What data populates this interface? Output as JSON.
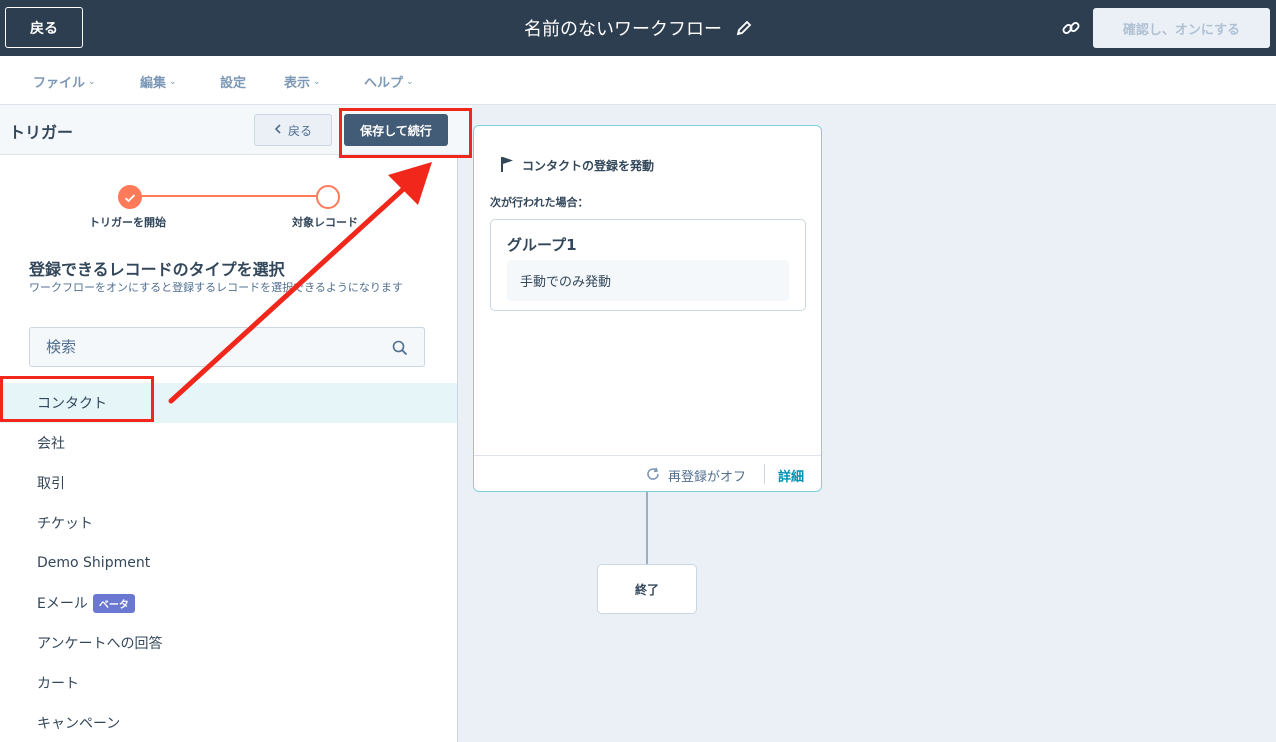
{
  "topbar": {
    "back_label": "戻る",
    "workflow_title": "名前のないワークフロー",
    "confirm_label": "確認し、オンにする"
  },
  "menu": {
    "items": [
      {
        "label": "ファイル",
        "has_dropdown": true
      },
      {
        "label": "編集",
        "has_dropdown": true
      },
      {
        "label": "設定",
        "has_dropdown": false
      },
      {
        "label": "表示",
        "has_dropdown": true
      },
      {
        "label": "ヘルプ",
        "has_dropdown": true
      }
    ]
  },
  "panel": {
    "title": "トリガー",
    "back_label": "戻る",
    "save_continue_label": "保存して続行",
    "steps": [
      {
        "label": "トリガーを開始",
        "done": true
      },
      {
        "label": "対象レコード",
        "done": false
      }
    ],
    "heading": "登録できるレコードのタイプを選択",
    "subheading": "ワークフローをオンにすると登録するレコードを選択できるようになります",
    "search_placeholder": "検索",
    "record_types": [
      {
        "label": "コンタクト",
        "selected": true
      },
      {
        "label": "会社"
      },
      {
        "label": "取引"
      },
      {
        "label": "チケット"
      },
      {
        "label": "Demo Shipment"
      },
      {
        "label": "Eメール",
        "badge": "ベータ"
      },
      {
        "label": "アンケートへの回答"
      },
      {
        "label": "カート"
      },
      {
        "label": "キャンペーン"
      }
    ]
  },
  "canvas": {
    "trigger_title": "コンタクトの登録を発動",
    "condition_label": "次が行われた場合：",
    "group_title": "グループ1",
    "group_condition": "手動でのみ発動",
    "reenroll_label": "再登録がオフ",
    "details_label": "詳細",
    "end_label": "終了"
  },
  "colors": {
    "topbar_bg": "#2d3e50",
    "accent_orange": "#ff7a59",
    "annotation_red": "#f0271a",
    "link_teal": "#0091ae",
    "beta_badge": "#6a78d1"
  }
}
